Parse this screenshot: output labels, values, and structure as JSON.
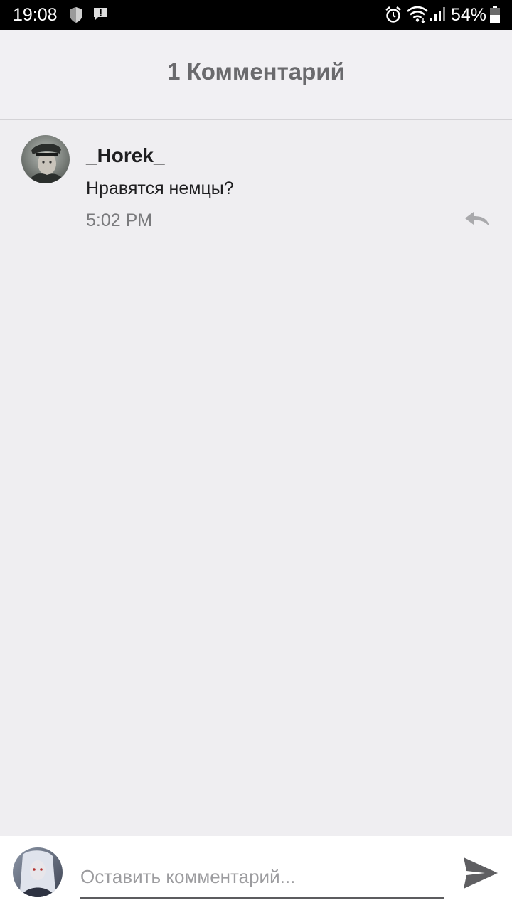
{
  "status_bar": {
    "time": "19:08",
    "battery_percent": "54%",
    "icons": [
      "shield-icon",
      "alert-icon",
      "alarm-icon",
      "wifi-icon",
      "signal-icon",
      "battery-icon"
    ]
  },
  "header": {
    "title": "1 Комментарий"
  },
  "comments": [
    {
      "author": "_Horek_",
      "text": "Нравятся немцы?",
      "time": "5:02 PM",
      "avatar": "avatar-icon",
      "reply_icon": "reply-icon"
    }
  ],
  "input": {
    "placeholder": "Оставить комментарий...",
    "value": ""
  },
  "colors": {
    "background": "#efeef1",
    "header_title": "#6a6a6d",
    "text_primary": "#1e1e20",
    "text_secondary": "#7a7a7d",
    "icon_gray": "#5f5f62"
  }
}
